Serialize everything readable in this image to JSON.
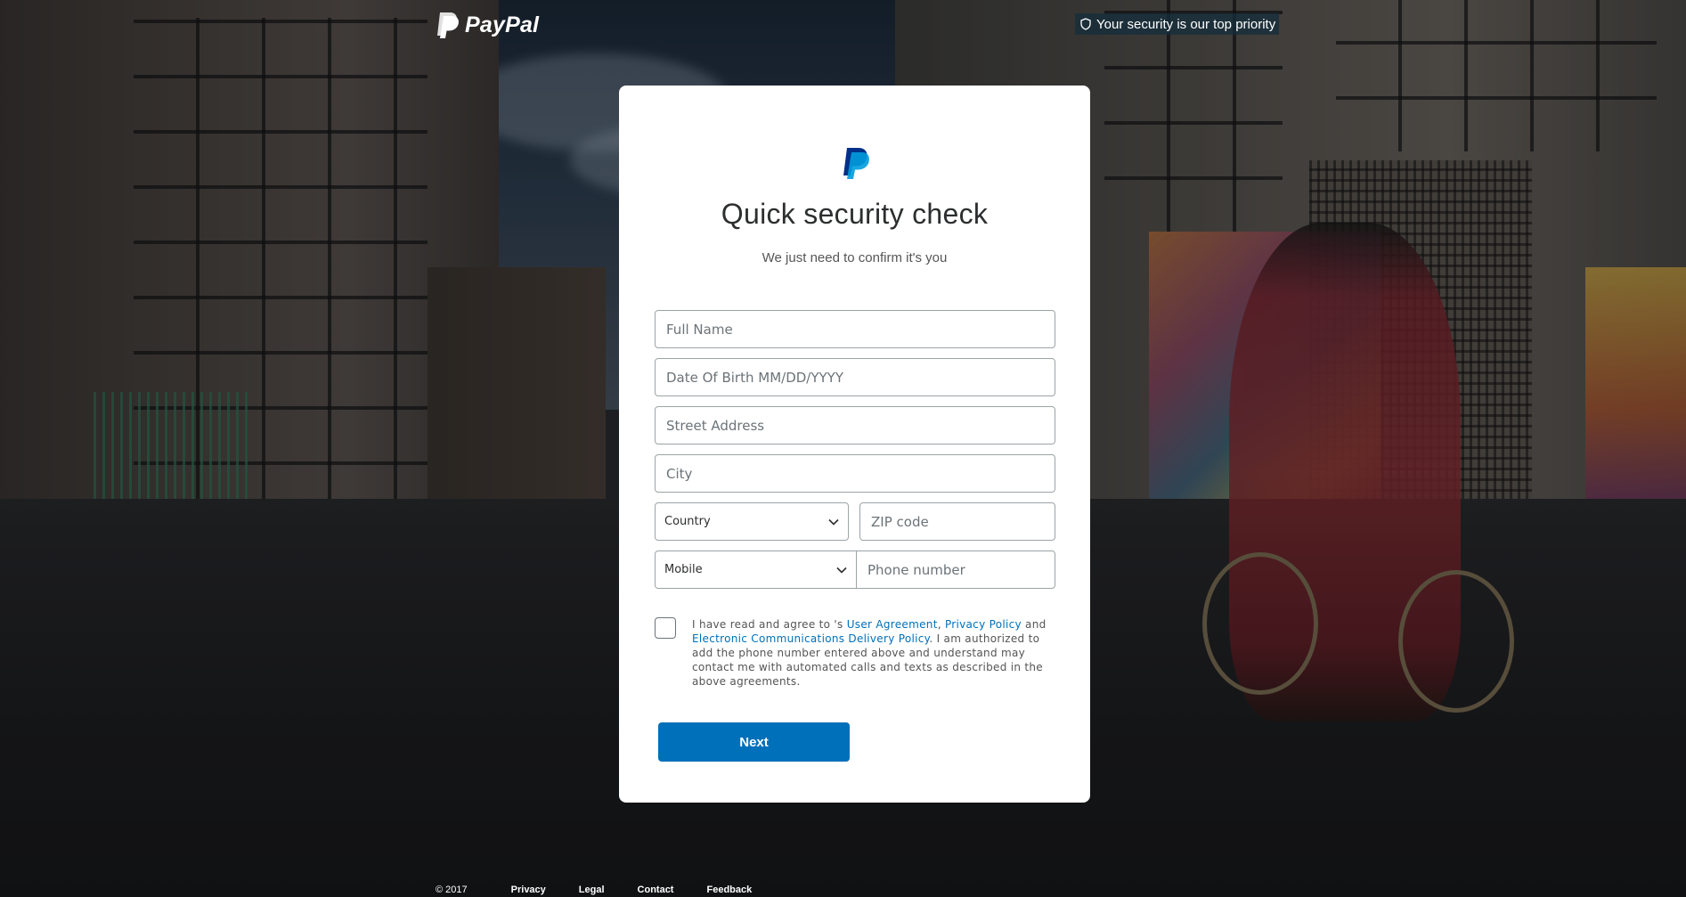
{
  "header": {
    "brand_text": "PayPal",
    "security_message": "Your security is our top priority"
  },
  "card": {
    "title": "Quick security check",
    "subtitle": "We just need to confirm it's you",
    "fields": {
      "full_name_placeholder": "Full Name",
      "dob_placeholder": "Date Of Birth MM/DD/YYYY",
      "street_placeholder": "Street Address",
      "city_placeholder": "City",
      "country_selected": "Country",
      "zip_placeholder": "ZIP code",
      "phone_type_selected": "Mobile",
      "phone_placeholder": "Phone number"
    },
    "agreement": {
      "prefix": "I have read and agree to 's ",
      "user_agreement": "User Agreement",
      "comma": ", ",
      "privacy_policy": "Privacy Policy",
      "and": " and ",
      "ecd_policy": "Electronic Communications Delivery Policy",
      "suffix": ". I am authorized to add the phone number entered above and understand may contact me with automated calls and texts as described in the above agreements."
    },
    "next_label": "Next"
  },
  "footer": {
    "copyright": "© 2017",
    "links": [
      "Privacy",
      "Legal",
      "Contact",
      "Feedback"
    ]
  },
  "colors": {
    "brand_blue": "#0070ba",
    "paypal_dark_blue": "#003087",
    "paypal_light_blue": "#009cde"
  },
  "icons": {
    "brand": "paypal-logo-icon",
    "security": "shield-icon",
    "dropdown": "chevron-down-icon"
  }
}
